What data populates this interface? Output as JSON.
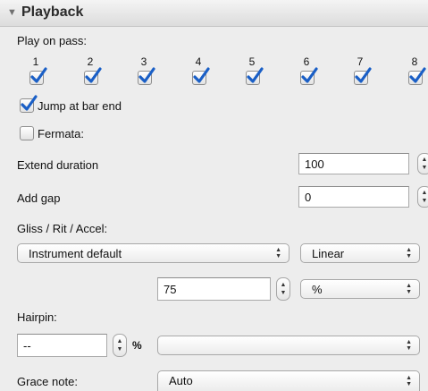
{
  "panel": {
    "title": "Playback",
    "collapse_glyph": "▼"
  },
  "play_on_pass": {
    "label": "Play on pass:",
    "passes": [
      {
        "number": "1",
        "checked": true
      },
      {
        "number": "2",
        "checked": true
      },
      {
        "number": "3",
        "checked": true
      },
      {
        "number": "4",
        "checked": true
      },
      {
        "number": "5",
        "checked": true
      },
      {
        "number": "6",
        "checked": true
      },
      {
        "number": "7",
        "checked": true
      },
      {
        "number": "8",
        "checked": true
      }
    ]
  },
  "jump_at_bar_end": {
    "label": "Jump at bar end",
    "checked": true
  },
  "fermata": {
    "label": "Fermata:",
    "checked": false
  },
  "extend_duration": {
    "label": "Extend duration",
    "value": "100"
  },
  "add_gap": {
    "label": "Add gap",
    "value": "0"
  },
  "gliss": {
    "label": "Gliss / Rit / Accel:",
    "style_value": "Instrument default",
    "curve_value": "Linear",
    "amount_value": "75",
    "unit_value": "%"
  },
  "hairpin": {
    "label": "Hairpin:",
    "value": "--",
    "unit": "%",
    "mode_value": ""
  },
  "grace_note": {
    "label": "Grace note:",
    "value": "Auto"
  },
  "colors": {
    "checkbox_accent": "#1a5fc6",
    "panel_bg": "#ededed"
  }
}
